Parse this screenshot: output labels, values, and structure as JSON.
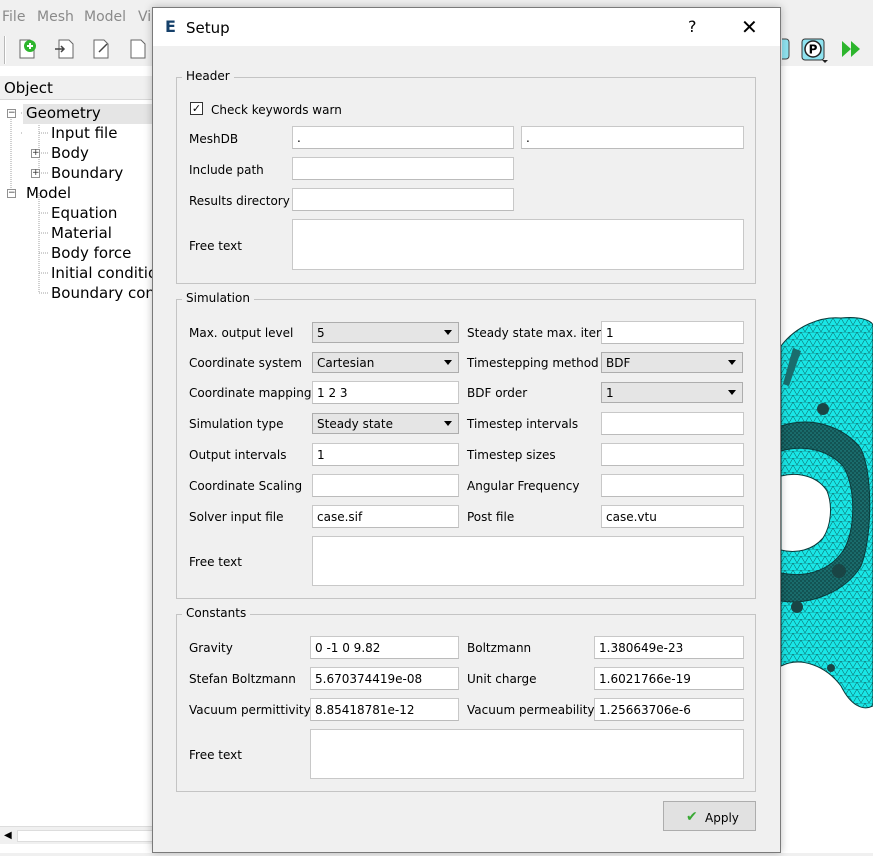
{
  "menu": [
    "File",
    "Mesh",
    "Model",
    "Vi"
  ],
  "object_panel": {
    "header": "Object",
    "tree": {
      "geometry": "Geometry",
      "input_file": "Input file",
      "body": "Body",
      "boundary": "Boundary",
      "model": "Model",
      "equation": "Equation",
      "material": "Material",
      "body_force": "Body force",
      "initial_condition": "Initial condition",
      "boundary_condition": "Boundary cond"
    }
  },
  "toolbar_right": {
    "p_button": "P"
  },
  "dialog": {
    "logo": "E",
    "title": "Setup",
    "help": "?",
    "close": "✕",
    "header": {
      "title": "Header",
      "check_keywords": {
        "label": "Check keywords warn",
        "checked": true
      },
      "meshdb": {
        "label": "MeshDB",
        "value1": ".",
        "value2": "."
      },
      "include_path": {
        "label": "Include path",
        "value": ""
      },
      "results_directory": {
        "label": "Results directory",
        "value": ""
      },
      "free_text": {
        "label": "Free text",
        "value": ""
      }
    },
    "simulation": {
      "title": "Simulation",
      "max_output_level": {
        "label": "Max. output level",
        "value": "5"
      },
      "coordinate_system": {
        "label": "Coordinate system",
        "value": "Cartesian"
      },
      "coordinate_mapping": {
        "label": "Coordinate mapping",
        "value": "1 2 3"
      },
      "simulation_type": {
        "label": "Simulation type",
        "value": "Steady state"
      },
      "output_intervals": {
        "label": "Output intervals",
        "value": "1"
      },
      "coordinate_scaling": {
        "label": "Coordinate Scaling",
        "value": ""
      },
      "solver_input_file": {
        "label": "Solver input file",
        "value": "case.sif"
      },
      "steady_state_max_iter": {
        "label": "Steady state max. iter",
        "value": "1"
      },
      "timestepping_method": {
        "label": "Timestepping method",
        "value": "BDF"
      },
      "bdf_order": {
        "label": "BDF order",
        "value": "1"
      },
      "timestep_intervals": {
        "label": "Timestep intervals",
        "value": ""
      },
      "timestep_sizes": {
        "label": "Timestep sizes",
        "value": ""
      },
      "angular_frequency": {
        "label": "Angular Frequency",
        "value": ""
      },
      "post_file": {
        "label": "Post file",
        "value": "case.vtu"
      },
      "free_text": {
        "label": "Free text",
        "value": ""
      }
    },
    "constants": {
      "title": "Constants",
      "gravity": {
        "label": "Gravity",
        "value": "0 -1 0 9.82"
      },
      "stefan_boltzmann": {
        "label": "Stefan Boltzmann",
        "value": "5.670374419e-08"
      },
      "vacuum_permittivity": {
        "label": "Vacuum permittivity",
        "value": "8.85418781e-12"
      },
      "boltzmann": {
        "label": "Boltzmann",
        "value": "1.380649e-23"
      },
      "unit_charge": {
        "label": "Unit charge",
        "value": "1.6021766e-19"
      },
      "vacuum_permeability": {
        "label": "Vacuum permeability",
        "value": "1.25663706e-6"
      },
      "free_text": {
        "label": "Free text",
        "value": ""
      }
    },
    "apply_label": "Apply"
  },
  "colors": {
    "mesh": "#19e6e6",
    "apply_check": "#3aa935",
    "logo": "#15406a"
  }
}
